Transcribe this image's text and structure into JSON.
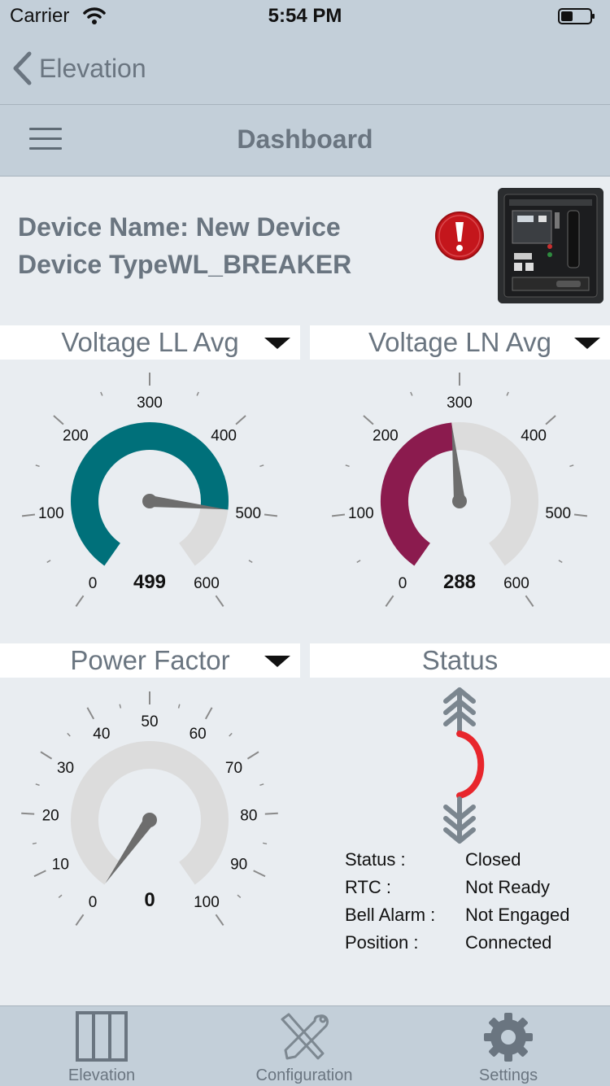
{
  "status_bar": {
    "carrier": "Carrier",
    "time": "5:54 PM"
  },
  "nav": {
    "back_label": "Elevation"
  },
  "header": {
    "title": "Dashboard"
  },
  "device": {
    "name_line": "Device Name: New Device",
    "type_line": "Device TypeWL_BREAKER"
  },
  "gauges": [
    {
      "title": "Voltage LL Avg",
      "value": "499",
      "value_num": 499,
      "min": 0,
      "max": 600,
      "ticks": [
        "0",
        "100",
        "200",
        "300",
        "400",
        "500",
        "600"
      ],
      "fill_color": "#00707a"
    },
    {
      "title": "Voltage LN Avg",
      "value": "288",
      "value_num": 288,
      "min": 0,
      "max": 600,
      "ticks": [
        "0",
        "100",
        "200",
        "300",
        "400",
        "500",
        "600"
      ],
      "fill_color": "#8b1b4e"
    },
    {
      "title": "Power Factor",
      "value": "0",
      "value_num": 0,
      "min": 0,
      "max": 100,
      "ticks": [
        "0",
        "10",
        "20",
        "30",
        "40",
        "50",
        "60",
        "70",
        "80",
        "90",
        "100"
      ],
      "fill_color": "#00707a"
    }
  ],
  "status_panel": {
    "title": "Status",
    "rows": [
      {
        "key": "Status :",
        "value": "Closed"
      },
      {
        "key": "RTC :",
        "value": "Not Ready"
      },
      {
        "key": "Bell Alarm :",
        "value": "Not Engaged"
      },
      {
        "key": "Position :",
        "value": "Connected"
      }
    ]
  },
  "tabs": [
    {
      "label": "Elevation",
      "icon": "elevation-icon"
    },
    {
      "label": "Configuration",
      "icon": "wrench-screwdriver-icon"
    },
    {
      "label": "Settings",
      "icon": "gear-icon"
    }
  ],
  "colors": {
    "bar_bg": "#c3cfd9",
    "page_bg": "#e9edf1",
    "alarm_red": "#c4161c",
    "status_red": "#e8262c"
  }
}
